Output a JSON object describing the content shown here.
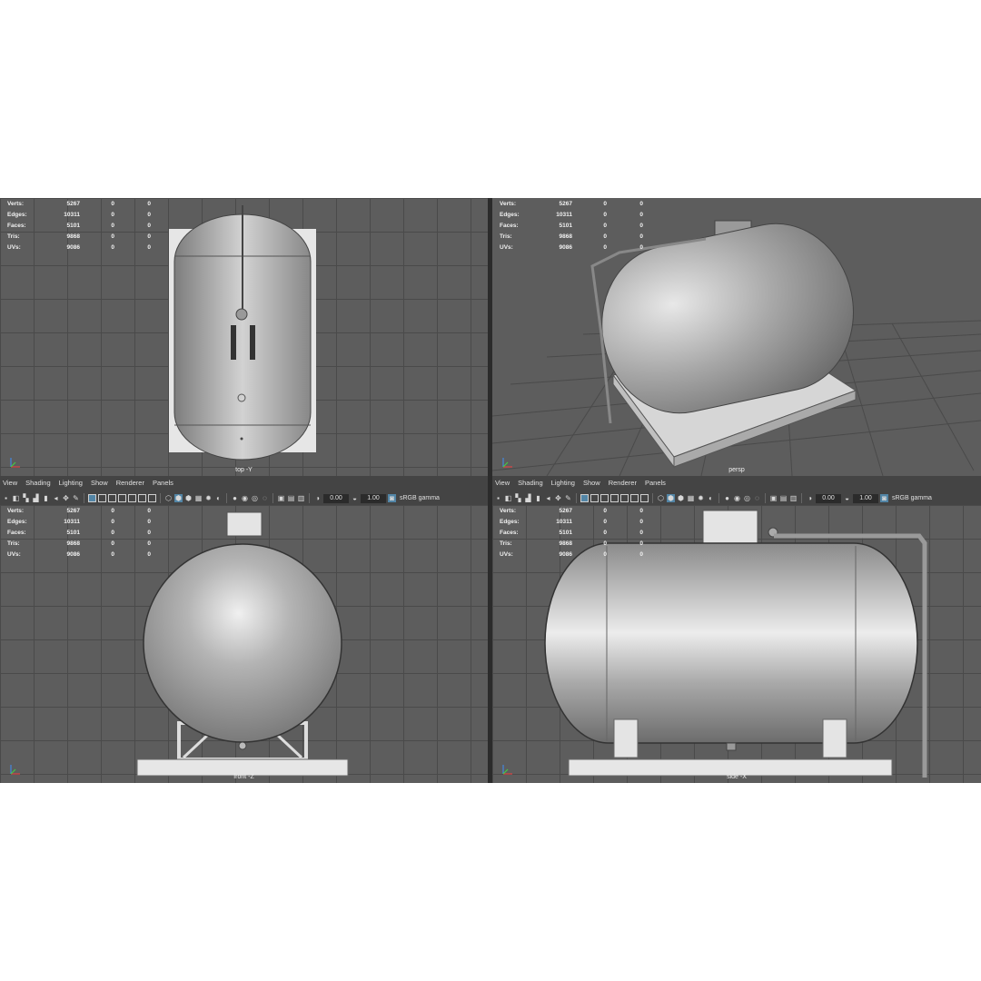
{
  "stats": {
    "rows": [
      {
        "label": "Verts:",
        "v1": "5267",
        "v2": "0",
        "v3": "0"
      },
      {
        "label": "Edges:",
        "v1": "10311",
        "v2": "0",
        "v3": "0"
      },
      {
        "label": "Faces:",
        "v1": "5101",
        "v2": "0",
        "v3": "0"
      },
      {
        "label": "Tris:",
        "v1": "9868",
        "v2": "0",
        "v3": "0"
      },
      {
        "label": "UVs:",
        "v1": "9086",
        "v2": "0",
        "v3": "0"
      }
    ]
  },
  "viewports": {
    "top": {
      "camera": "top -Y"
    },
    "persp": {
      "camera": "persp"
    },
    "front": {
      "camera": "front -Z"
    },
    "side": {
      "camera": "side -X"
    }
  },
  "panel_menu": {
    "view": "View",
    "shading": "Shading",
    "lighting": "Lighting",
    "show": "Show",
    "renderer": "Renderer",
    "panels": "Panels"
  },
  "panel_toolbar": {
    "exposure": "0.00",
    "gamma": "1.00",
    "color_space": "sRGB gamma"
  },
  "colors": {
    "viewport_bg": "#5d5d5d",
    "grid": "#4a4a4a",
    "panel_bar": "#444444",
    "active_tool": "#5285a6"
  }
}
